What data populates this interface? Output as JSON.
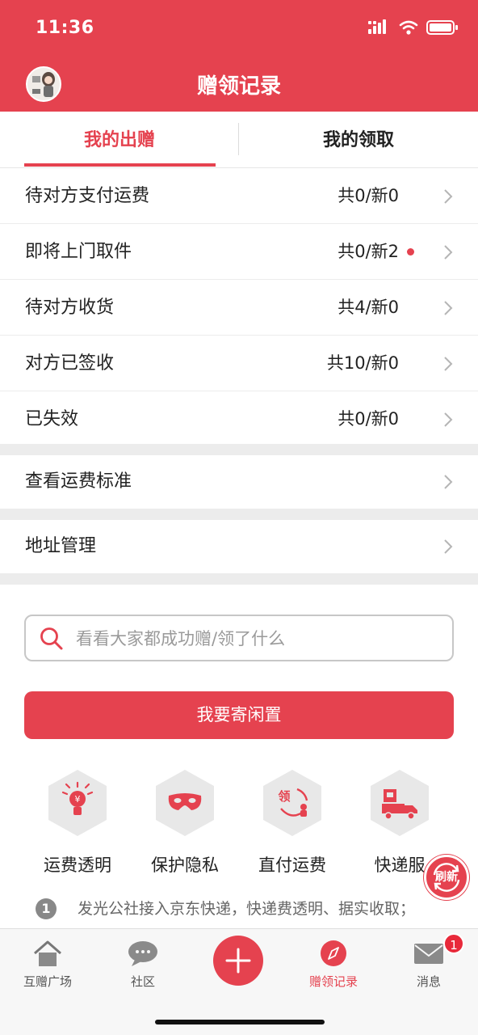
{
  "status_bar": {
    "time": "11:36"
  },
  "header": {
    "title": "赠领记录"
  },
  "tabs": [
    {
      "label": "我的出赠",
      "active": true
    },
    {
      "label": "我的领取",
      "active": false
    }
  ],
  "give_rows": [
    {
      "label": "待对方支付运费",
      "count": "共0/新0",
      "dot": false
    },
    {
      "label": "即将上门取件",
      "count": "共0/新2",
      "dot": true
    },
    {
      "label": "待对方收货",
      "count": "共4/新0",
      "dot": false
    },
    {
      "label": "对方已签收",
      "count": "共10/新0",
      "dot": false
    },
    {
      "label": "已失效",
      "count": "共0/新0",
      "dot": false
    }
  ],
  "links": [
    {
      "label": "查看运费标准"
    },
    {
      "label": "地址管理"
    }
  ],
  "search": {
    "placeholder": "看看大家都成功赠/领了什么"
  },
  "main_button": {
    "label": "我要寄闲置"
  },
  "features": [
    {
      "label": "运费透明",
      "icon": "bulb-yen-icon"
    },
    {
      "label": "保护隐私",
      "icon": "mask-icon"
    },
    {
      "label": "直付运费",
      "icon": "pay-shipping-icon"
    },
    {
      "label": "快递服",
      "icon": "delivery-truck-icon"
    }
  ],
  "refresh": {
    "label": "刷新"
  },
  "info": {
    "number": "1",
    "text": "发光公社接入京东快递，快递费透明、据实收取；"
  },
  "tabbar": [
    {
      "label": "互赠广场",
      "icon": "home-icon",
      "active": false
    },
    {
      "label": "社区",
      "icon": "chat-bubble-icon",
      "active": false
    },
    {
      "label": "",
      "icon": "plus-icon",
      "active": false
    },
    {
      "label": "赠领记录",
      "icon": "compass-icon",
      "active": true
    },
    {
      "label": "消息",
      "icon": "mail-icon",
      "active": false
    }
  ],
  "message_badge": "1",
  "colors": {
    "accent": "#e5424f",
    "gap": "#ececec",
    "hex_bg": "#e8e8e8"
  }
}
